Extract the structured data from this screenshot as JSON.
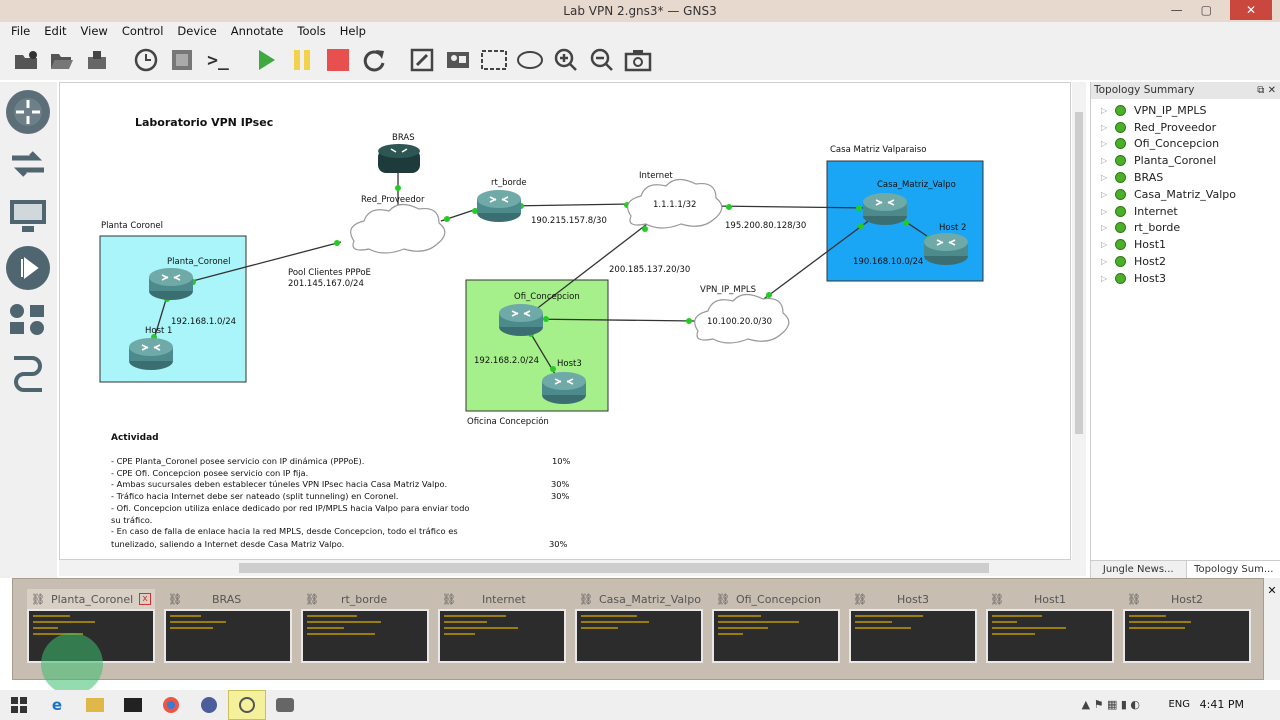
{
  "window": {
    "title": "Lab VPN 2.gns3* — GNS3",
    "min": "—",
    "max": "▢",
    "close": "✕"
  },
  "menu": [
    "File",
    "Edit",
    "View",
    "Control",
    "Device",
    "Annotate",
    "Tools",
    "Help"
  ],
  "toolbar": {
    "icons": [
      "folder-new-icon",
      "folder-open-icon",
      "save-icon",
      "clock-icon",
      "snapshot-icon",
      "terminal-icon",
      "start-icon",
      "pause-icon",
      "stop-icon",
      "reload-icon",
      "note-icon",
      "picture-icon",
      "rectangle-icon",
      "ellipse-icon",
      "zoom-in-icon",
      "zoom-out-icon",
      "camera-icon"
    ],
    "terminal_glyph": ">_"
  },
  "leftbar": {
    "icons": [
      "routers-icon",
      "switches-icon",
      "end-devices-icon",
      "security-icon",
      "all-devices-icon",
      "add-link-icon"
    ]
  },
  "canvas": {
    "title": "Laboratorio VPN IPsec",
    "labels": {
      "planta_area": "Planta Coronel",
      "oficina_area": "Oficina Concepción",
      "casa_area": "Casa Matriz Valparaiso",
      "bras": "BRAS",
      "red_proveedor": "Red_Proveedor",
      "rt_borde": "rt_borde",
      "internet": "Internet",
      "internet_ip": "1.1.1.1/32",
      "casa_matriz": "Casa_Matriz_Valpo",
      "host2": "Host 2",
      "casa_net": "190.168.10.0/24",
      "planta_router": "Planta_Coronel",
      "host1": "Host 1",
      "planta_net": "192.168.1.0/24",
      "pool": "Pool Clientes PPPoE",
      "pool_net": "201.145.167.0/24",
      "link_rt_internet": "190.215.157.8/30",
      "link_internet_casa": "195.200.80.128/30",
      "link_internet_ofi": "200.185.137.20/30",
      "vpn_cloud": "VPN_IP_MPLS",
      "vpn_net": "10.100.20.0/30",
      "ofi_router": "Ofi_Concepcion",
      "ofi_net": "192.168.2.0/24",
      "host3": "Host3"
    },
    "activity": {
      "title": "Actividad",
      "lines": [
        {
          "text": "- CPE Planta_Coronel posee servicio con IP dinámica (PPPoE).",
          "pct": "10%"
        },
        {
          "text": "- CPE Ofi. Concepcion posee servicio con IP fija.",
          "pct": ""
        },
        {
          "text": "- Ambas sucursales deben establecer túneles VPN IPsec hacia Casa Matriz Valpo.",
          "pct": "30%"
        },
        {
          "text": "- Tráfico hacia Internet debe ser nateado (split tunneling) en Coronel.",
          "pct": "30%"
        },
        {
          "text": "- Ofi. Concepcion utiliza enlace dedicado por red IP/MPLS hacia Valpo para enviar todo",
          "pct": ""
        },
        {
          "text": "su tráfico.",
          "pct": ""
        },
        {
          "text": "- En caso de falla de enlace hacia la red MPLS, desde Concepcion, todo el tráfico es",
          "pct": ""
        },
        {
          "text": "tunelizado, saliendo a Internet desde Casa Matriz Valpo.",
          "pct": "30%"
        }
      ]
    }
  },
  "topology": {
    "title": "Topology Summary",
    "items": [
      "VPN_IP_MPLS",
      "Red_Proveedor",
      "Ofi_Concepcion",
      "Planta_Coronel",
      "BRAS",
      "Casa_Matriz_Valpo",
      "Internet",
      "rt_borde",
      "Host1",
      "Host2",
      "Host3"
    ],
    "tabs": [
      "Jungle News...",
      "Topology Sum..."
    ],
    "controls": "⧉ ✕"
  },
  "consoles": [
    "Planta_Coronel",
    "BRAS",
    "rt_borde",
    "Internet",
    "Casa_Matriz_Valpo",
    "Ofi_Concepcion",
    "Host3",
    "Host1",
    "Host2"
  ],
  "taskbar": {
    "lang": "ENG",
    "time": "4:41 PM"
  },
  "colors": {
    "planta": "#aaf5fa",
    "oficina": "#a5f08a",
    "casa": "#1aa6f5",
    "router": "#4c8a8c",
    "link_dot": "#22cc22"
  }
}
